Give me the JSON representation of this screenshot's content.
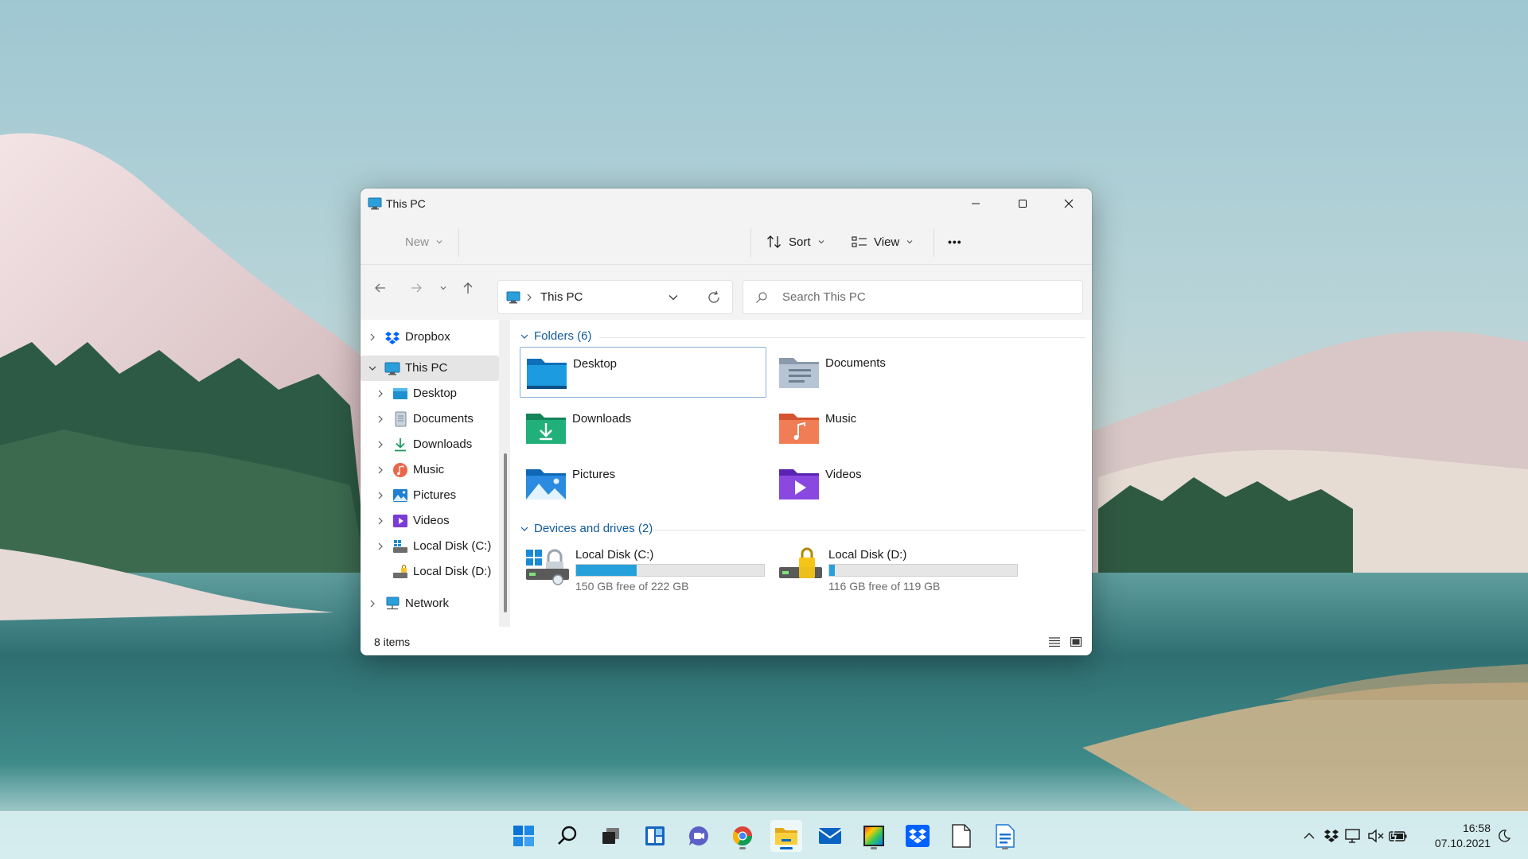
{
  "window": {
    "title": "This PC",
    "buttons": {
      "minimize": "minimize",
      "maximize": "maximize",
      "close": "close"
    }
  },
  "toolbar": {
    "new_label": "New",
    "sort_label": "Sort",
    "view_label": "View",
    "more_label": "•••"
  },
  "address": {
    "location": "This PC",
    "search_placeholder": "Search This PC"
  },
  "sidebar": {
    "items": [
      {
        "label": "Dropbox",
        "icon": "dropbox-icon",
        "level": 0,
        "expanded": false
      },
      {
        "label": "This PC",
        "icon": "computer-icon",
        "level": 0,
        "expanded": true,
        "selected": true
      },
      {
        "label": "Desktop",
        "icon": "desktop-folder-icon",
        "level": 1
      },
      {
        "label": "Documents",
        "icon": "documents-icon",
        "level": 1
      },
      {
        "label": "Downloads",
        "icon": "download-icon",
        "level": 1
      },
      {
        "label": "Music",
        "icon": "music-icon",
        "level": 1
      },
      {
        "label": "Pictures",
        "icon": "pictures-icon",
        "level": 1
      },
      {
        "label": "Videos",
        "icon": "videos-icon",
        "level": 1
      },
      {
        "label": "Local Disk (C:)",
        "icon": "drive-icon",
        "level": 1
      },
      {
        "label": "Local Disk (D:)",
        "icon": "locked-drive-icon",
        "level": 1
      },
      {
        "label": "Network",
        "icon": "network-icon",
        "level": 0
      }
    ]
  },
  "content": {
    "folders_header": "Folders (6)",
    "folders": [
      {
        "label": "Desktop",
        "icon": "desktop-folder-icon",
        "selected": true
      },
      {
        "label": "Documents",
        "icon": "documents-folder-icon"
      },
      {
        "label": "Downloads",
        "icon": "downloads-folder-icon"
      },
      {
        "label": "Music",
        "icon": "music-folder-icon"
      },
      {
        "label": "Pictures",
        "icon": "pictures-folder-icon"
      },
      {
        "label": "Videos",
        "icon": "videos-folder-icon"
      }
    ],
    "drives_header": "Devices and drives (2)",
    "drives": [
      {
        "label": "Local Disk (C:)",
        "free": "150 GB free of 222 GB",
        "used_fraction": 0.32,
        "icon": "system-drive-icon"
      },
      {
        "label": "Local Disk (D:)",
        "free": "116 GB free of 119 GB",
        "used_fraction": 0.03,
        "icon": "bitlocker-drive-icon"
      }
    ]
  },
  "status": {
    "items_count": "8 items"
  },
  "taskbar": {
    "icons": [
      "windows-start-icon",
      "search-icon",
      "task-view-icon",
      "widgets-icon",
      "chat-icon",
      "chrome-icon",
      "file-explorer-icon",
      "mail-icon",
      "photo-app-icon",
      "dropbox-icon",
      "notepad-icon",
      "document-editor-icon"
    ],
    "time": "16:58",
    "date": "07.10.2021"
  },
  "colors": {
    "accent": "#0067c0",
    "drive_fill": "#26a0da",
    "group_header": "#0f5a9c"
  }
}
